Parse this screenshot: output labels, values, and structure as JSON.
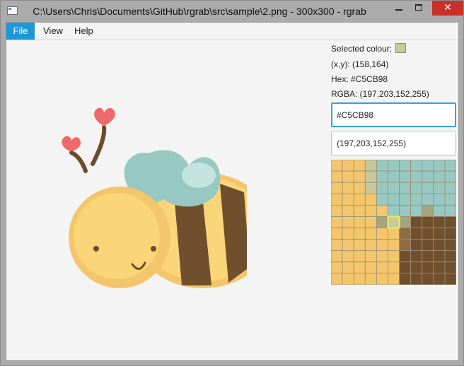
{
  "window": {
    "title": "C:\\Users\\Chris\\Documents\\GitHub\\rgrab\\src\\sample\\2.png - 300x300 - rgrab",
    "close_glyph": "✕"
  },
  "menu": {
    "file": "File",
    "view": "View",
    "help": "Help"
  },
  "info": {
    "selected_label": "Selected colour:",
    "xy": "(x,y): (158,164)",
    "hex": "Hex: #C5CB98",
    "rgba": "RGBA: (197,203,152,255)",
    "selected_color": "#C5CB98"
  },
  "fields": {
    "hex_value": "#C5CB98",
    "rgba_value": "(197,203,152,255)"
  },
  "colors": {
    "yellow": "#F4C66B",
    "teal": "#97C9C2",
    "teal_olive": "#C4C99C",
    "olive_gray": "#A6A47E",
    "olive_dark": "#928C76",
    "brown": "#70502C",
    "brown_light": "#8E6C44",
    "grid_line": "#9C8E78",
    "highlight": "#E4F05E"
  },
  "zoom_grid": {
    "rows": 11,
    "cols": 11,
    "highlight_row": 5,
    "highlight_col": 5,
    "cells": [
      "YYYLTTTTTTT",
      "YYYLTTTTTTT",
      "YYYLTTTTTTT",
      "YYYYTTTTTTT",
      "YYYYYTTTOTT",
      "YYYYODOBBBB",
      "YYYYYYKBBBB",
      "YYYYYYKBBBB",
      "YYYYYYBBBBB",
      "YYYYYYBBBBB",
      "YYYYYYBBBBB"
    ]
  }
}
